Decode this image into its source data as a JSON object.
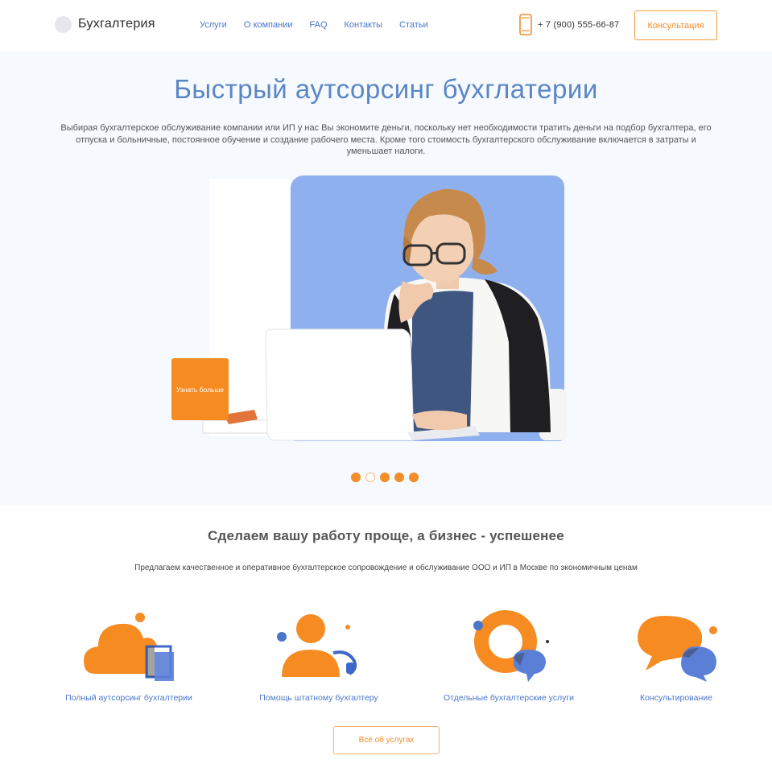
{
  "header": {
    "logo_text": "Бухгалтерия",
    "nav": [
      "Услуги",
      "О компании",
      "FAQ",
      "Контакты",
      "Статьи"
    ],
    "phone": "+ 7 (900) 555-66-87",
    "consult_button": "Консультация"
  },
  "hero": {
    "title": "Быстрый аутсорсинг бухглатерии",
    "description": "Выбирая бухгалтерское обслуживание компании или ИП у нас Вы экономите деньги, поскольку нет необходимости тратить деньги на подбор бухгалтера, его отпуска и больничные, постоянное обучение и создание рабочего места. Кроме того стоимость бухгалтерского обслуживание включается в затраты и уменьшает налоги.",
    "learn_more_button": "Узнать больше",
    "slider": {
      "total": 5,
      "active": 2
    }
  },
  "services": {
    "title": "Сделаем вашу работу проще, а бизнес - успешенее",
    "subtitle": "Предлагаем качественное и оперативное бухгалтерское сопровождение и обслуживание ООО и ИП в Москве по экономичным ценам",
    "items": [
      {
        "label": "Полный аутсорсинг бухгалтерии",
        "icon": "cloud-documents-icon"
      },
      {
        "label": "Помощь штатному бухгалтеру",
        "icon": "support-agent-icon"
      },
      {
        "label": "Отдельные бухгалтерские услуги",
        "icon": "donut-chat-icon"
      },
      {
        "label": "Консультирование",
        "icon": "chat-bubbles-icon"
      }
    ],
    "all_services_button": "Всё об услугах"
  },
  "colors": {
    "accent_orange": "#f28d27",
    "accent_blue": "#4a76c9",
    "illustration_blue": "#8fb0ef",
    "hero_bg": "#f6f9fd"
  }
}
